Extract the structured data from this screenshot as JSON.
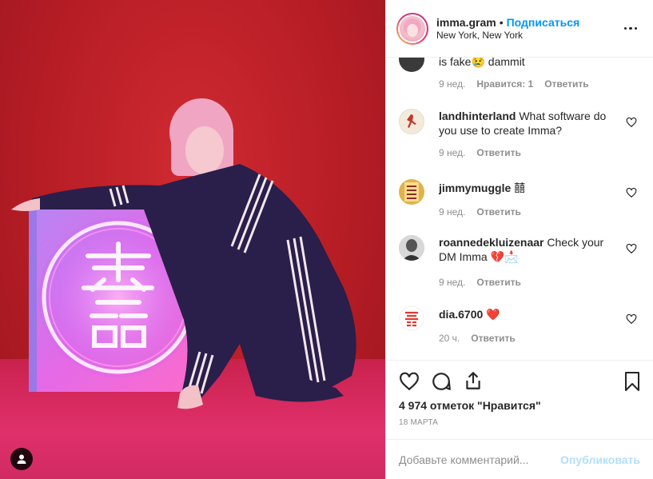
{
  "post": {
    "username": "imma.gram",
    "separator": "•",
    "follow_label": "Подписаться",
    "location": "New York, New York"
  },
  "comments": [
    {
      "avatar": "dark-avatar",
      "text": "is fake",
      "emoji": "😢",
      "text_after": " dammit",
      "time": "9 нед.",
      "likes": "Нравится: 1",
      "reply": "Ответить"
    },
    {
      "avatar": "jordan-logo-avatar",
      "username": "landhinterland",
      "text": " What software do you use to create Imma?",
      "time": "9 нед.",
      "reply": "Ответить"
    },
    {
      "avatar": "yellow-pattern-avatar",
      "username": "jimmymuggle",
      "text": " 囍",
      "time": "9 нед.",
      "reply": "Ответить"
    },
    {
      "avatar": "portrait-avatar",
      "username": "roannedekluizenaar",
      "text": " Check your DM Imma ",
      "emoji": "💔📩",
      "time": "9 нед.",
      "reply": "Ответить"
    },
    {
      "avatar": "red-symbol-avatar",
      "username": "dia.6700",
      "text": " ",
      "emoji": "❤️",
      "time": "20 ч.",
      "reply": "Ответить"
    }
  ],
  "likes_count": "4 974 отметок \"Нравится\"",
  "date": "18 МАРТА",
  "add_comment": {
    "placeholder": "Добавьте комментарий...",
    "post_label": "Опубликовать"
  },
  "colors": {
    "accent": "#0095f6",
    "post_disabled": "#b2dffc",
    "secondary_text": "#8e8e8e",
    "background_red": "#b71d25",
    "neon_pink": "#ff4fd1"
  },
  "icons": {
    "like": "heart-icon",
    "comment": "comment-bubble-icon",
    "share": "share-icon",
    "save": "bookmark-icon",
    "more": "more-options-icon",
    "user_tag": "user-tag-icon"
  }
}
